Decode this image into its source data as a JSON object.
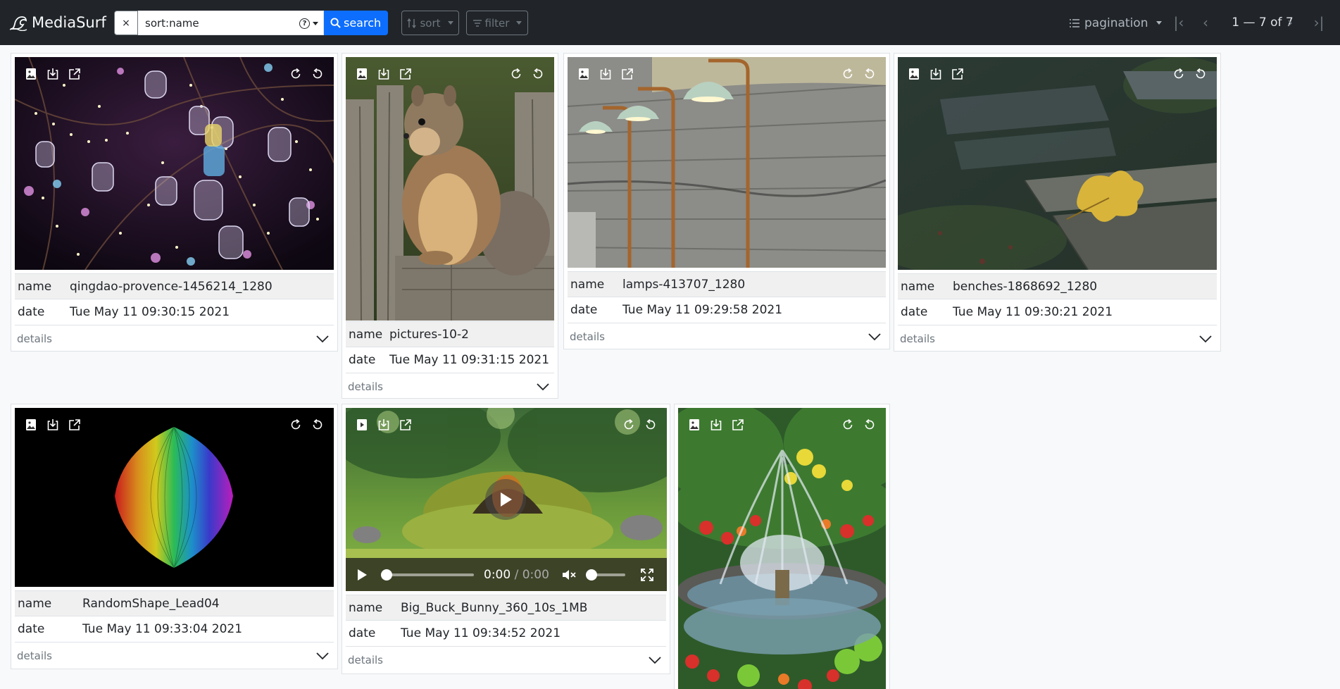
{
  "app": {
    "name": "MediaSurf"
  },
  "search": {
    "clear_label": "×",
    "query": "sort:name",
    "help_icon": "question-circle-icon",
    "button_label": "search"
  },
  "toolbar": {
    "sort_label": "sort",
    "filter_label": "filter",
    "pagination_label": "pagination"
  },
  "pagination": {
    "first_label": "|‹",
    "prev_label": "‹",
    "range_label": "1 — 7 of 7",
    "next_label": "›",
    "last_label": "›|"
  },
  "card_labels": {
    "name": "name",
    "date": "date",
    "details": "details"
  },
  "media_tools": [
    "image-icon",
    "download-icon",
    "open-external-icon",
    "rotate-cw-icon",
    "rotate-ccw-icon"
  ],
  "cards": [
    {
      "kind": "image",
      "name": "qingdao-provence-1456214_1280",
      "date": "Tue May 11 09:30:15 2021",
      "scene": "lanterns-night"
    },
    {
      "kind": "image",
      "name": "pictures-10-2",
      "date": "Tue May 11 09:31:15 2021",
      "scene": "squirrel-fence"
    },
    {
      "kind": "image",
      "name": "lamps-413707_1280",
      "date": "Tue May 11 09:29:58 2021",
      "scene": "lamps-wall"
    },
    {
      "kind": "image",
      "name": "benches-1868692_1280",
      "date": "Tue May 11 09:30:21 2021",
      "scene": "bench-leaf"
    },
    {
      "kind": "image",
      "name": "RandomShape_Lead04",
      "date": "Tue May 11 09:33:04 2021",
      "scene": "rainbow-shape"
    },
    {
      "kind": "video",
      "name": "Big_Buck_Bunny_360_10s_1MB",
      "date": "Tue May 11 09:34:52 2021",
      "scene": "forest-tree"
    },
    {
      "kind": "image",
      "name": "",
      "date": "",
      "scene": "garden-fountain"
    }
  ],
  "video": {
    "current_time": "0:00",
    "separator": " / ",
    "duration": "0:00"
  },
  "colors": {
    "navbar": "#212529",
    "primary": "#0d6efd",
    "page": "#f8f9fa"
  }
}
